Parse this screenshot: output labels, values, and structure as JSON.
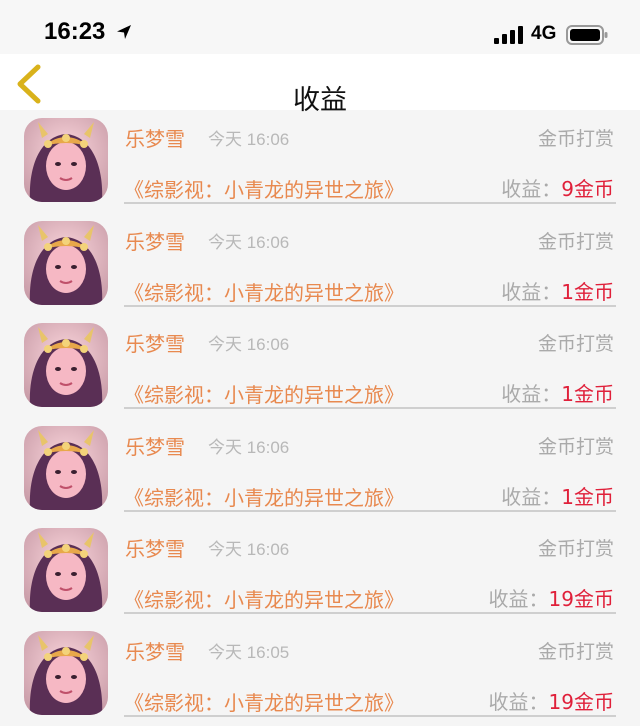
{
  "status_bar": {
    "time": "16:23",
    "location_icon": "location-arrow-icon",
    "signal_icon": "cellular-signal-icon",
    "network": "4G",
    "battery_icon": "battery-icon"
  },
  "nav": {
    "back_icon": "chevron-left-icon",
    "title": "收益",
    "accent_color": "#d9b21b"
  },
  "colors": {
    "name": "#e8894f",
    "book": "#e8894f",
    "muted": "#aaaaaa",
    "amount": "#e0203a"
  },
  "earnings": [
    {
      "name": "乐梦雪",
      "time": "今天 16:06",
      "type": "金币打赏",
      "book": "《综影视：小青龙的异世之旅》",
      "label": "收益",
      "colon": "：",
      "amount": "9金币"
    },
    {
      "name": "乐梦雪",
      "time": "今天 16:06",
      "type": "金币打赏",
      "book": "《综影视：小青龙的异世之旅》",
      "label": "收益",
      "colon": "：",
      "amount": "1金币"
    },
    {
      "name": "乐梦雪",
      "time": "今天 16:06",
      "type": "金币打赏",
      "book": "《综影视：小青龙的异世之旅》",
      "label": "收益",
      "colon": "：",
      "amount": "1金币"
    },
    {
      "name": "乐梦雪",
      "time": "今天 16:06",
      "type": "金币打赏",
      "book": "《综影视：小青龙的异世之旅》",
      "label": "收益",
      "colon": "：",
      "amount": "1金币"
    },
    {
      "name": "乐梦雪",
      "time": "今天 16:06",
      "type": "金币打赏",
      "book": "《综影视：小青龙的异世之旅》",
      "label": "收益",
      "colon": "：",
      "amount": "19金币"
    },
    {
      "name": "乐梦雪",
      "time": "今天 16:05",
      "type": "金币打赏",
      "book": "《综影视：小青龙的异世之旅》",
      "label": "收益",
      "colon": "：",
      "amount": "19金币"
    }
  ]
}
